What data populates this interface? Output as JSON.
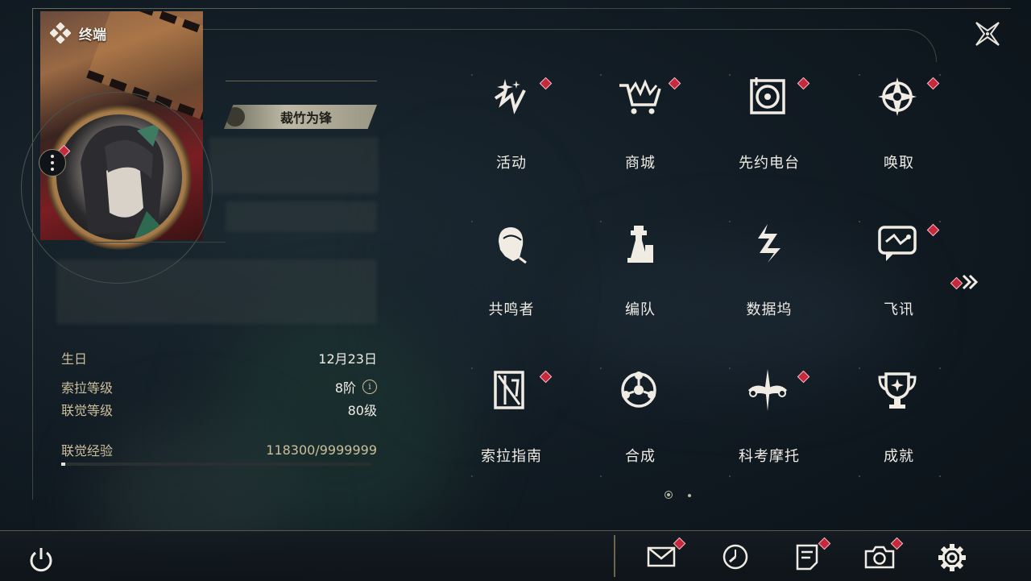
{
  "header": {
    "title": "终端"
  },
  "profile": {
    "name": "裁竹为锋"
  },
  "stats": [
    {
      "label": "生日",
      "value": "12月23日"
    },
    {
      "label": "索拉等级",
      "value": "8阶"
    },
    {
      "label": "联觉等级",
      "value": "80级"
    },
    {
      "label": "联觉经验",
      "value": "118300/9999999"
    }
  ],
  "experience_fraction": 0.0118,
  "menu": [
    {
      "label": "活动",
      "icon": "event-icon",
      "badge": true
    },
    {
      "label": "商城",
      "icon": "shop-cart-icon",
      "badge": true
    },
    {
      "label": "先约电台",
      "icon": "radio-icon",
      "badge": true
    },
    {
      "label": "唤取",
      "icon": "compass-star-icon",
      "badge": true
    },
    {
      "label": "共鸣者",
      "icon": "character-head-icon",
      "badge": false
    },
    {
      "label": "编队",
      "icon": "chess-piece-icon",
      "badge": false
    },
    {
      "label": "数据坞",
      "icon": "data-dock-icon",
      "badge": false
    },
    {
      "label": "飞讯",
      "icon": "chat-bubble-icon",
      "badge": true
    },
    {
      "label": "索拉指南",
      "icon": "guidebook-icon",
      "badge": true
    },
    {
      "label": "合成",
      "icon": "synthesis-icon",
      "badge": false
    },
    {
      "label": "科考摩托",
      "icon": "motorbike-icon",
      "badge": true
    },
    {
      "label": "成就",
      "icon": "trophy-icon",
      "badge": false
    }
  ],
  "pagination": {
    "pages": 2,
    "current": 1
  },
  "bottom_bar": [
    {
      "icon": "mail-icon",
      "badge": true
    },
    {
      "icon": "clock-icon",
      "badge": false
    },
    {
      "icon": "notes-icon",
      "badge": true
    },
    {
      "icon": "camera-icon",
      "badge": true
    },
    {
      "icon": "settings-gear-icon",
      "badge": false
    }
  ],
  "colors": {
    "badge": "#c8283c",
    "accent_gold": "#cbbf9c",
    "text": "#f0ece4"
  }
}
